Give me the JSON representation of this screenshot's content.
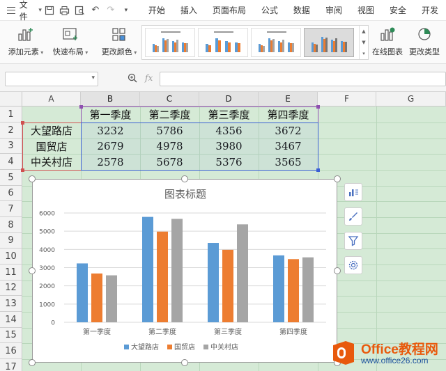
{
  "menubar": {
    "file_label": "文件",
    "tabs": [
      "开始",
      "插入",
      "页面布局",
      "公式",
      "数据",
      "审阅",
      "视图",
      "安全",
      "开发"
    ]
  },
  "ribbon": {
    "add_element": "添加元素",
    "quick_layout": "快速布局",
    "change_color": "更改颜色",
    "online_chart": "在线图表",
    "change_type": "更改类型"
  },
  "formula_bar": {
    "name_box": "",
    "fx_label": "fx",
    "formula": ""
  },
  "sheet": {
    "columns": [
      "A",
      "B",
      "C",
      "D",
      "E",
      "F",
      "G"
    ],
    "rows": [
      "1",
      "2",
      "3",
      "4",
      "5",
      "6",
      "7",
      "8",
      "9",
      "10",
      "11",
      "12",
      "13",
      "14",
      "15",
      "16",
      "17"
    ],
    "headers": [
      "第一季度",
      "第二季度",
      "第三季度",
      "第四季度"
    ],
    "data": [
      {
        "store": "大望路店",
        "values": [
          "3232",
          "5786",
          "4356",
          "3672"
        ]
      },
      {
        "store": "国贸店",
        "values": [
          "2679",
          "4978",
          "3980",
          "3467"
        ]
      },
      {
        "store": "中关村店",
        "values": [
          "2578",
          "5678",
          "5376",
          "3565"
        ]
      }
    ]
  },
  "chart_data": {
    "type": "bar",
    "title": "图表标题",
    "categories": [
      "第一季度",
      "第二季度",
      "第三季度",
      "第四季度"
    ],
    "series": [
      {
        "name": "大望路店",
        "values": [
          3232,
          5786,
          4356,
          3672
        ],
        "color": "#5b9bd5"
      },
      {
        "name": "国贸店",
        "values": [
          2679,
          4978,
          3980,
          3467
        ],
        "color": "#ed7d31"
      },
      {
        "name": "中关村店",
        "values": [
          2578,
          5678,
          5376,
          3565
        ],
        "color": "#a5a5a5"
      }
    ],
    "ylim": [
      0,
      6000
    ],
    "yticks": [
      "0",
      "1000",
      "2000",
      "3000",
      "4000",
      "5000",
      "6000"
    ],
    "grid": true,
    "legend": "bottom"
  },
  "side_tools": [
    "chart-elements-icon",
    "chart-style-icon",
    "chart-filter-icon",
    "chart-settings-icon"
  ],
  "watermark": {
    "brand": "Office教程网",
    "url": "www.office26.com"
  }
}
